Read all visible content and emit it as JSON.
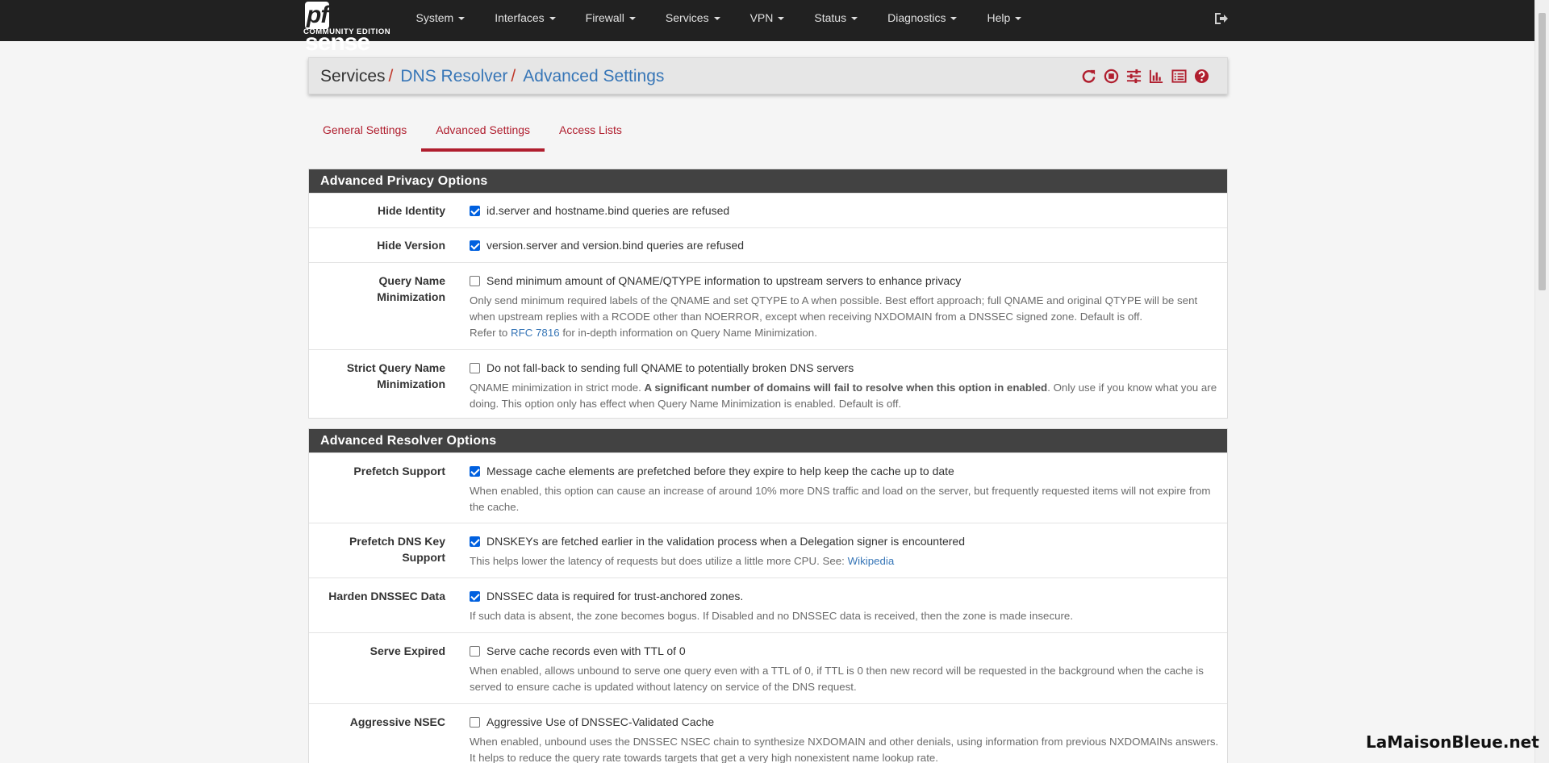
{
  "brand": {
    "name_pf": "pf",
    "name_rest": "sense",
    "edition": "COMMUNITY EDITION"
  },
  "nav": [
    "System",
    "Interfaces",
    "Firewall",
    "Services",
    "VPN",
    "Status",
    "Diagnostics",
    "Help"
  ],
  "breadcrumb": {
    "root": "Services",
    "level1": "DNS Resolver",
    "level2": "Advanced Settings",
    "separator": "/"
  },
  "tabs": [
    "General Settings",
    "Advanced Settings",
    "Access Lists"
  ],
  "active_tab": "Advanced Settings",
  "privacy": {
    "title": "Advanced Privacy Options",
    "hide_identity": {
      "label": "Hide Identity",
      "text": "id.server and hostname.bind queries are refused",
      "checked": true
    },
    "hide_version": {
      "label": "Hide Version",
      "text": "version.server and version.bind queries are refused",
      "checked": true
    },
    "qname_min": {
      "label_1": "Query Name",
      "label_2": "Minimization",
      "text": "Send minimum amount of QNAME/QTYPE information to upstream servers to enhance privacy",
      "checked": false,
      "help_1": "Only send minimum required labels of the QNAME and set QTYPE to A when possible. Best effort approach; full QNAME and original QTYPE will be sent when upstream replies with a RCODE other than NOERROR, except when receiving NXDOMAIN from a DNSSEC signed zone. Default is off.",
      "help_refer": "Refer to",
      "help_link": "RFC 7816",
      "help_2": "for in-depth information on Query Name Minimization."
    },
    "strict_qname": {
      "label_1": "Strict Query Name",
      "label_2": "Minimization",
      "text": "Do not fall-back to sending full QNAME to potentially broken DNS servers",
      "checked": false,
      "help_1": "QNAME minimization in strict mode.",
      "help_bold": "A significant number of domains will fail to resolve when this option in enabled",
      "help_2": ". Only use if you know what you are doing. This option only has effect when Query Name Minimization is enabled. Default is off."
    }
  },
  "resolver": {
    "title": "Advanced Resolver Options",
    "prefetch": {
      "label": "Prefetch Support",
      "text": "Message cache elements are prefetched before they expire to help keep the cache up to date",
      "checked": true,
      "help": "When enabled, this option can cause an increase of around 10% more DNS traffic and load on the server, but frequently requested items will not expire from the cache."
    },
    "prefetch_key": {
      "label_1": "Prefetch DNS Key",
      "label_2": "Support",
      "text": "DNSKEYs are fetched earlier in the validation process when a Delegation signer is encountered",
      "checked": true,
      "help": "This helps lower the latency of requests but does utilize a little more CPU. See:",
      "help_link": "Wikipedia"
    },
    "harden": {
      "label": "Harden DNSSEC Data",
      "text": "DNSSEC data is required for trust-anchored zones.",
      "checked": true,
      "help": "If such data is absent, the zone becomes bogus. If Disabled and no DNSSEC data is received, then the zone is made insecure."
    },
    "serve_expired": {
      "label": "Serve Expired",
      "text": "Serve cache records even with TTL of 0",
      "checked": false,
      "help": "When enabled, allows unbound to serve one query even with a TTL of 0, if TTL is 0 then new record will be requested in the background when the cache is served to ensure cache is updated without latency on service of the DNS request."
    },
    "aggressive": {
      "label": "Aggressive NSEC",
      "text": "Aggressive Use of DNSSEC-Validated Cache",
      "checked": false,
      "help": "When enabled, unbound uses the DNSSEC NSEC chain to synthesize NXDOMAIN and other denials, using information from previous NXDOMAINs answers. It helps to reduce the query rate towards targets that get a very high nonexistent name lookup rate."
    }
  },
  "watermark": "LaMaisonBleue.net",
  "colors": {
    "navbar": "#212121",
    "accent": "#b01e2e",
    "link": "#3776b7",
    "panel_head": "#424242"
  }
}
